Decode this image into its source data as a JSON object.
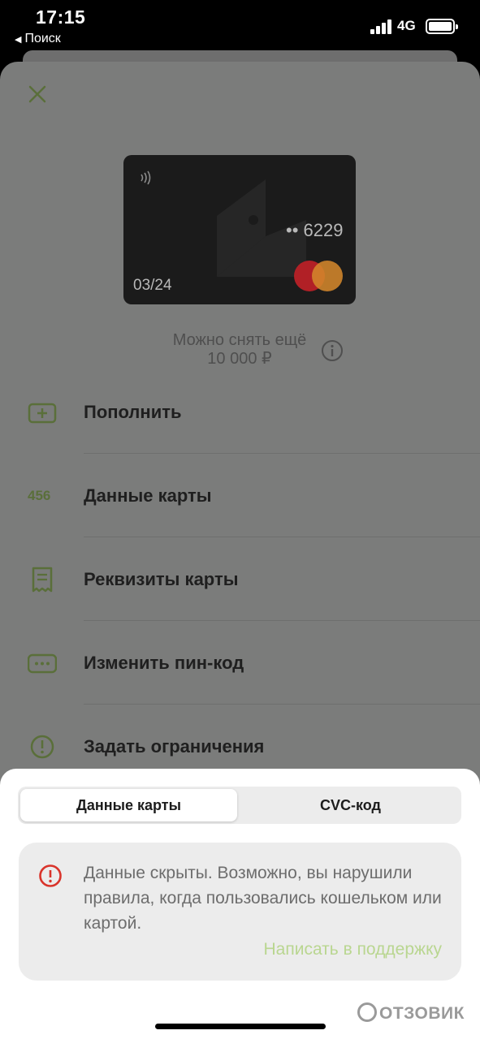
{
  "status_bar": {
    "time": "17:15",
    "back_label": "Поиск",
    "network": "4G"
  },
  "card": {
    "last4": "•• 6229",
    "expiry": "03/24"
  },
  "withdraw": {
    "line1": "Можно снять ещё",
    "line2": "10 000 ₽"
  },
  "menu": [
    {
      "label": "Пополнить",
      "icon": "plus-square-icon"
    },
    {
      "label": "Данные карты",
      "icon_text": "456"
    },
    {
      "label": "Реквизиты карты",
      "icon": "document-icon"
    },
    {
      "label": "Изменить пин-код",
      "icon": "pin-dots-icon"
    },
    {
      "label": "Задать ограничения",
      "icon": "exclamation-circle-icon"
    }
  ],
  "sheet": {
    "tabs": [
      "Данные карты",
      "CVC-код"
    ],
    "active_tab": 0,
    "message": "Данные скрыты. Возможно, вы нарушили правила, когда пользовались кошельком или картой.",
    "support_link": "Написать в поддержку"
  },
  "watermark": "ОТЗОВИК",
  "colors": {
    "accent": "#b9d690",
    "icon_green": "#5a6f3a",
    "warning": "#d9342b",
    "overlay": "#7b7c7b"
  }
}
